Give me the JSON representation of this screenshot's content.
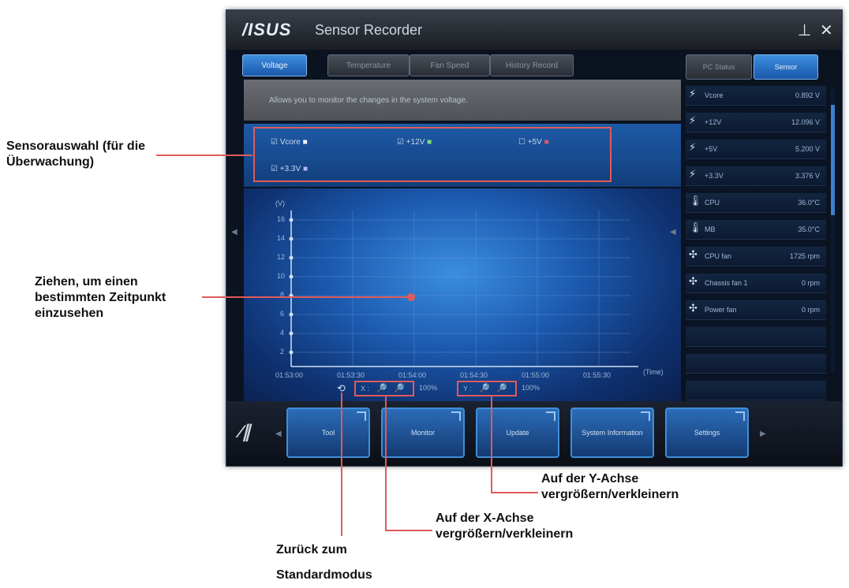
{
  "window": {
    "logo": "/ISUS",
    "title": "Sensor Recorder",
    "minimize_icon": "⊥",
    "close_icon": "✕"
  },
  "tabs": [
    {
      "label": "Voltage",
      "active": true
    },
    {
      "label": "Temperature",
      "active": false
    },
    {
      "label": "Fan Speed",
      "active": false
    },
    {
      "label": "History Record",
      "active": false
    }
  ],
  "description": "Allows you to monitor the changes in the system voltage.",
  "sensors": [
    {
      "label": "Vcore",
      "checked": true,
      "color": "#ffffff"
    },
    {
      "label": "+12V",
      "checked": true,
      "color": "#7ee07e"
    },
    {
      "label": "+5V",
      "checked": false,
      "color": "#e05a5a"
    },
    {
      "label": "+3.3V",
      "checked": true,
      "color": "#b0b8ff"
    }
  ],
  "chart": {
    "y_unit": "(V)",
    "y_ticks": [
      "16",
      "14",
      "12",
      "10",
      "8",
      "6",
      "4",
      "2"
    ],
    "x_unit": "(Time)",
    "x_ticks": [
      "01:53:00",
      "01:53:30",
      "01:54:00",
      "01:54:30",
      "01:55:00",
      "01:55:30"
    ]
  },
  "zoom": {
    "reset_icon": "⟲",
    "x_label": "X :",
    "x_percent": "100%",
    "y_label": "Y :",
    "y_percent": "100%"
  },
  "sidebar": {
    "tabs": [
      {
        "label": "PC Status",
        "active": false
      },
      {
        "label": "Sensor",
        "active": true
      }
    ],
    "items": [
      {
        "icon": "bolt-icon",
        "glyph": "⚡",
        "name": "Vcore",
        "value": "0.892 V"
      },
      {
        "icon": "bolt-icon",
        "glyph": "⚡",
        "name": "+12V",
        "value": "12.096 V"
      },
      {
        "icon": "bolt-icon",
        "glyph": "⚡",
        "name": "+5V",
        "value": "5.200 V"
      },
      {
        "icon": "bolt-icon",
        "glyph": "⚡",
        "name": "+3.3V",
        "value": "3.376 V"
      },
      {
        "icon": "thermometer-icon",
        "glyph": "🌡",
        "name": "CPU",
        "value": "36.0°C"
      },
      {
        "icon": "thermometer-icon",
        "glyph": "🌡",
        "name": "MB",
        "value": "35.0°C"
      },
      {
        "icon": "fan-icon",
        "glyph": "✣",
        "name": "CPU fan",
        "value": "1725 rpm"
      },
      {
        "icon": "fan-icon",
        "glyph": "✣",
        "name": "Chassis fan 1",
        "value": "0 rpm"
      },
      {
        "icon": "fan-icon",
        "glyph": "✣",
        "name": "Power fan",
        "value": "0 rpm"
      }
    ]
  },
  "dock": {
    "buttons": [
      "Tool",
      "Monitor",
      "Update",
      "System Information",
      "Settings"
    ]
  },
  "callouts": {
    "sensor_select": "Sensorauswahl (für die Überwachung)",
    "drag_time": "Ziehen, um einen bestimmten Zeitpunkt einzusehen",
    "y_zoom": "Auf der Y-Achse vergrößern/verkleinern",
    "x_zoom": "Auf der X-Achse vergrößern/verkleinern",
    "reset": "Zurück zum Standardmodus"
  },
  "colors": {
    "accent": "#3d8fe0",
    "callout_line": "#e05a5a"
  }
}
